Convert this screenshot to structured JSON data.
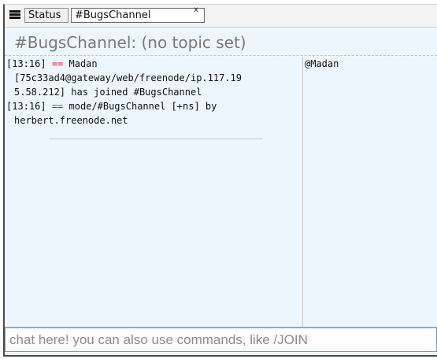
{
  "tabs": {
    "menu_icon": "hamburger-menu-icon",
    "items": [
      {
        "label": "Status"
      },
      {
        "label": "#BugsChannel",
        "close": "x"
      }
    ]
  },
  "topic": "#BugsChannel: (no topic set)",
  "messages": [
    {
      "lines": [
        {
          "time": "[13:16]",
          "marker": "==",
          "text": "Madan"
        },
        {
          "text": "[75c33ad4@gateway/web/freenode/ip.117.19"
        },
        {
          "text": "5.58.212] has joined #BugsChannel"
        }
      ]
    },
    {
      "lines": [
        {
          "time": "[13:16]",
          "marker": "==",
          "text": "mode/#BugsChannel [+ns] by"
        },
        {
          "text": "herbert.freenode.net"
        }
      ]
    }
  ],
  "nicklist": [
    "@Madan"
  ],
  "input": {
    "placeholder": "chat here! you can also use commands, like /JOIN"
  },
  "colors": {
    "accent": "#d9141f",
    "panel_bg": "#eef6fd",
    "tab_bg": "#f3f3f3"
  }
}
